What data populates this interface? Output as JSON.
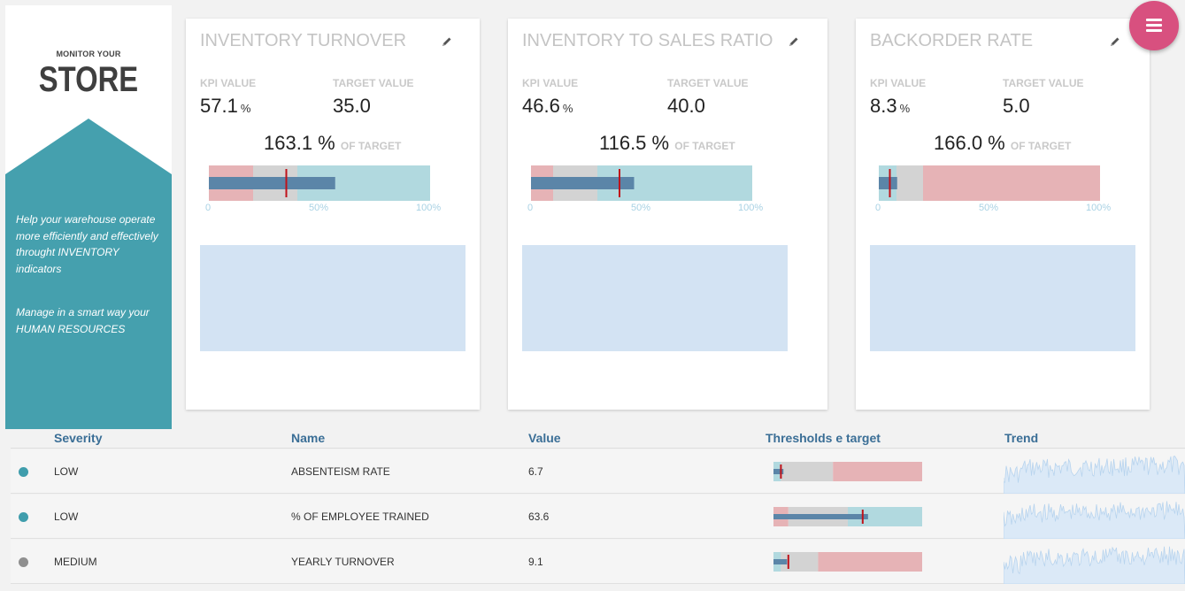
{
  "sidebar": {
    "brand_small": "MONITOR YOUR",
    "brand_big": "STORE",
    "text1": "Help your warehouse operate more efficiently and effectively throught INVENTORY indicators",
    "text2": "Manage in a smart way your HUMAN RESOURCES",
    "color": "#45a0ae"
  },
  "labels": {
    "kpi": "KPI VALUE",
    "target": "TARGET VALUE",
    "of_target": "OF TARGET",
    "tick0": "0",
    "tick50": "50%",
    "tick100": "100%"
  },
  "cards": [
    {
      "title": "INVENTORY TURNOVER",
      "kpi": "57.1",
      "unit": "%",
      "target": "35.0",
      "pct": "163.1 %",
      "bullet": {
        "bands": [
          [
            "#e6b3b6",
            0.2
          ],
          [
            "#d3d3d3",
            0.2
          ],
          [
            "#b1d9df",
            0.6
          ]
        ],
        "measure": 0.571,
        "marker": 0.35
      }
    },
    {
      "title": "INVENTORY TO SALES RATIO",
      "kpi": "46.6",
      "unit": "%",
      "target": "40.0",
      "pct": "116.5 %",
      "bullet": {
        "bands": [
          [
            "#e6b3b6",
            0.1
          ],
          [
            "#d3d3d3",
            0.2
          ],
          [
            "#b1d9df",
            0.7
          ]
        ],
        "measure": 0.466,
        "marker": 0.4
      }
    },
    {
      "title": "BACKORDER RATE",
      "kpi": "8.3",
      "unit": "%",
      "target": "5.0",
      "pct": "166.0 %",
      "bullet": {
        "bands": [
          [
            "#b1d9df",
            0.08
          ],
          [
            "#d3d3d3",
            0.12
          ],
          [
            "#e6b3b6",
            0.8
          ]
        ],
        "measure": 0.083,
        "marker": 0.05
      }
    }
  ],
  "table": {
    "headers": {
      "severity": "Severity",
      "name": "Name",
      "value": "Value",
      "thresholds": "Thresholds e target",
      "trend": "Trend"
    },
    "rows": [
      {
        "severity": "LOW",
        "dot": "#3f9dac",
        "name": "ABSENTEISM RATE",
        "value": "6.7",
        "bullet": {
          "bands": [
            [
              "#b1d9df",
              0.05
            ],
            [
              "#d3d3d3",
              0.35
            ],
            [
              "#e6b3b6",
              0.6
            ]
          ],
          "measure": 0.067,
          "marker": 0.05
        }
      },
      {
        "severity": "LOW",
        "dot": "#3f9dac",
        "name": "% OF EMPLOYEE TRAINED",
        "value": "63.6",
        "bullet": {
          "bands": [
            [
              "#e6b3b6",
              0.1
            ],
            [
              "#d3d3d3",
              0.4
            ],
            [
              "#b1d9df",
              0.5
            ]
          ],
          "measure": 0.636,
          "marker": 0.6
        }
      },
      {
        "severity": "MEDIUM",
        "dot": "#8f8f8f",
        "name": "YEARLY TURNOVER",
        "value": "9.1",
        "bullet": {
          "bands": [
            [
              "#b1d9df",
              0.05
            ],
            [
              "#d3d3d3",
              0.25
            ],
            [
              "#e6b3b6",
              0.7
            ]
          ],
          "measure": 0.091,
          "marker": 0.1
        }
      }
    ]
  },
  "colors": {
    "measure": "#5b85a8",
    "marker": "#c0121a",
    "fab": "#d8507f",
    "header": "#3a6e96",
    "sparkline": "#b8d4ee"
  }
}
